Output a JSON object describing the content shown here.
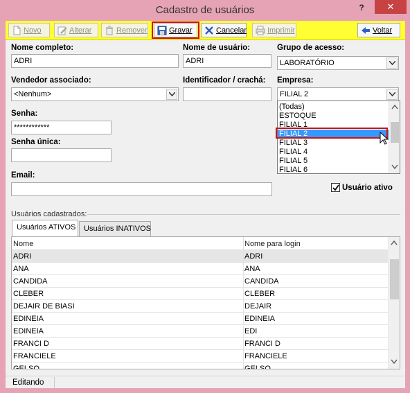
{
  "window": {
    "title": "Cadastro de usuários",
    "help": "?",
    "close": "✕"
  },
  "toolbar": {
    "novo": "Novo",
    "alterar": "Alterar",
    "remover": "Remover",
    "gravar": "Gravar",
    "cancelar": "Cancelar",
    "imprimir": "Imprimir",
    "voltar": "Voltar"
  },
  "form": {
    "nome_completo_label": "Nome completo:",
    "nome_completo_value": "ADRI",
    "nome_usuario_label": "Nome de usuário:",
    "nome_usuario_value": "ADRI",
    "grupo_label": "Grupo de acesso:",
    "grupo_value": "LABORATÓRIO",
    "vendedor_label": "Vendedor associado:",
    "vendedor_value": "<Nenhum>",
    "identificador_label": "Identificador / crachá:",
    "identificador_value": "",
    "empresa_label": "Empresa:",
    "empresa_value": "FILIAL 2",
    "senha_label": "Senha:",
    "senha_value": "************",
    "senha_unica_label": "Senha única:",
    "senha_unica_value": "",
    "email_label": "Email:",
    "email_value": "",
    "usuario_ativo_label": "Usuário ativo",
    "usuario_ativo_checked": true
  },
  "empresa_dropdown": {
    "options": [
      "(Todas)",
      "ESTOQUE",
      "FILIAL 1",
      "FILIAL 2",
      "FILIAL 3",
      "FILIAL 4",
      "FILIAL 5",
      "FILIAL 6"
    ],
    "selected": "FILIAL 2"
  },
  "users_section": {
    "label": "Usuários cadastrados:",
    "tab_active": "Usuários ATIVOS",
    "tab_inactive": "Usuários INATIVOS",
    "col_name": "Nome",
    "col_login": "Nome para login",
    "rows": [
      [
        "ADRI",
        "ADRI"
      ],
      [
        "ANA",
        "ANA"
      ],
      [
        "CANDIDA",
        "CANDIDA"
      ],
      [
        "CLEBER",
        "CLEBER"
      ],
      [
        "DEJAIR DE BIASI",
        "DEJAIR"
      ],
      [
        "EDINEIA",
        "EDINEIA"
      ],
      [
        "EDINEIA",
        "EDI"
      ],
      [
        "FRANCI D",
        "FRANCI D"
      ],
      [
        "FRANCIELE",
        "FRANCIELE"
      ],
      [
        "GELSO",
        "GELSO"
      ]
    ]
  },
  "status": {
    "text": "Editando"
  }
}
